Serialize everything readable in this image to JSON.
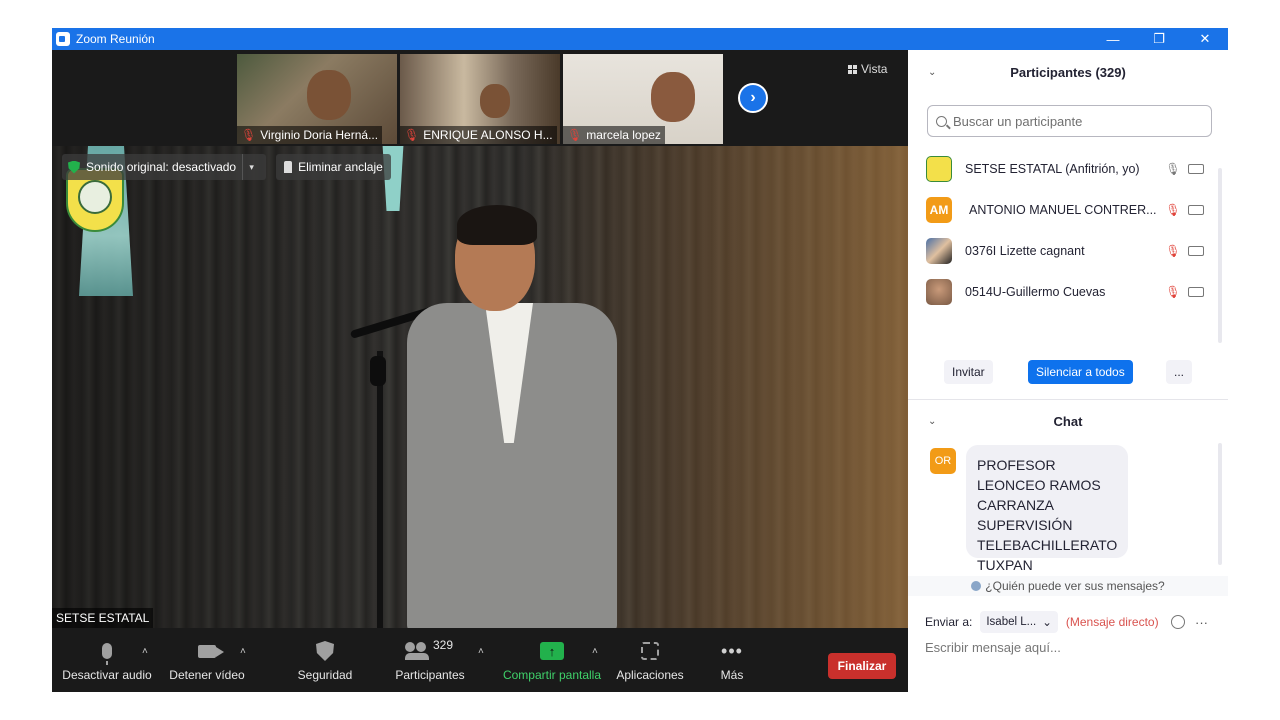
{
  "window": {
    "title": "Zoom Reunión",
    "minimize": "—",
    "restore": "❐",
    "close": "✕"
  },
  "thumbnails": [
    {
      "name": "Virginio Doria Herná..."
    },
    {
      "name": "ENRIQUE ALONSO H..."
    },
    {
      "name": "marcela lopez"
    }
  ],
  "view_label": "Vista",
  "next_arrow": "›",
  "video_controls": {
    "sound_label": "Sonido original: desactivado",
    "dropdown_arrow": "▾",
    "unpin_label": "Eliminar anclaje",
    "speaker_name": "SETSE ESTATAL"
  },
  "toolbar": {
    "caret": "˄",
    "mute_label": "Desactivar audio",
    "video_label": "Detener vídeo",
    "security_label": "Seguridad",
    "participants_label": "Participantes",
    "participants_count": "329",
    "share_label": "Compartir pantalla",
    "share_arrow": "↑",
    "apps_label": "Aplicaciones",
    "more_label": "Más",
    "more_glyph": "•••",
    "end_label": "Finalizar"
  },
  "participants_panel": {
    "title": "Participantes (329)",
    "chevron": "⌄",
    "search_placeholder": "Buscar un participante",
    "items": [
      {
        "name": "SETSE ESTATAL (Anfitrión, yo)",
        "mic": "on",
        "avatar_text": ""
      },
      {
        "name": "ANTONIO MANUEL CONTRER...",
        "mic": "off",
        "avatar_text": "AM"
      },
      {
        "name": "0376I Lizette cagnant",
        "mic": "off",
        "avatar_text": ""
      },
      {
        "name": "0514U-Guillermo Cuevas",
        "mic": "off",
        "avatar_text": ""
      }
    ],
    "invite_label": "Invitar",
    "mute_all_label": "Silenciar a todos",
    "more_label": "..."
  },
  "chat_panel": {
    "title": "Chat",
    "chevron": "⌄",
    "messages": [
      {
        "avatar": "OR",
        "text": "PROFESOR LEONCEO RAMOS CARRANZA SUPERVISIÓN TELEBACHILLERATO TUXPAN"
      }
    ],
    "who_can_see": "¿Quién puede ver sus mensajes?",
    "send_to_label": "Enviar a:",
    "send_to_value": "Isabel L...",
    "direct_label": "(Mensaje directo)",
    "more_glyph": "···",
    "input_placeholder": "Escribir mensaje aquí..."
  },
  "colors": {
    "accent": "#1a73e8",
    "end_button": "#c9302c",
    "share_green": "#22b14c",
    "muted_red": "#e0433a",
    "avatar_orange": "#f29b17"
  }
}
